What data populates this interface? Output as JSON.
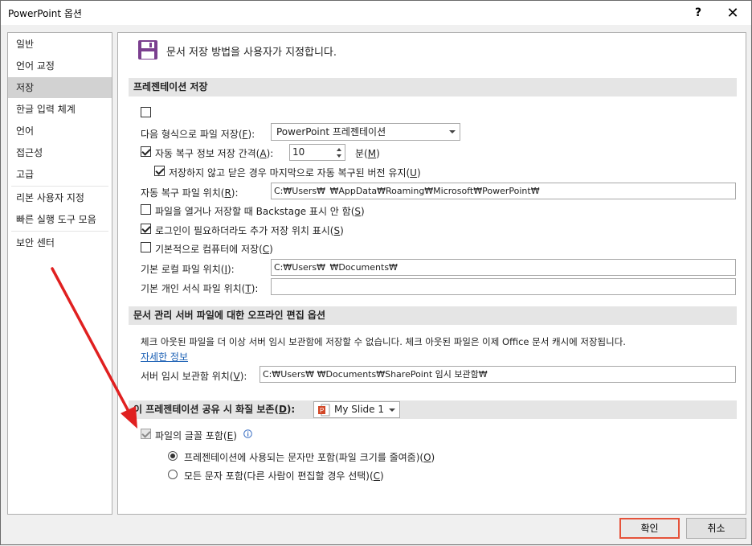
{
  "window": {
    "title": "PowerPoint 옵션",
    "help_label": "?",
    "close_label": "✕"
  },
  "nav": {
    "items": [
      "일반",
      "언어 교정",
      "저장",
      "한글 입력 체계",
      "언어",
      "접근성",
      "고급",
      "리본 사용자 지정",
      "빠른 실행 도구 모음",
      "보안 센터"
    ],
    "selected": "저장"
  },
  "content": {
    "header": "문서 저장 방법을 사용자가 지정합니다.",
    "sections": {
      "save_presentations": "프레젠테이션 저장",
      "offline_editing": "문서 관리 서버 파일에 대한 오프라인 편집 옵션",
      "fidelity": "이 프레젠테이션 공유 시 화질 보존",
      "fidelity_key": "D",
      "fidelity_suffix": "):"
    },
    "save": {
      "format_label": "다음 형식으로 파일 저장(",
      "format_key": "F",
      "format_suffix": "):",
      "format_value": "PowerPoint 프레젠테이션",
      "autorecover_label": "자동 복구 정보 저장 간격(",
      "autorecover_key": "A",
      "autorecover_suffix": "):",
      "autorecover_value": "10",
      "minutes_label": "분(",
      "minutes_key": "M",
      "minutes_suffix": ")",
      "keep_last_label": "저장하지 않고 닫은 경우 마지막으로 자동 복구된 버전 유지(",
      "keep_last_key": "U",
      "keep_last_suffix": ")",
      "autorecover_path_label": "자동 복구 파일 위치(",
      "autorecover_path_key": "R",
      "autorecover_path_suffix": "):",
      "autorecover_path_value": "C:₩Users₩   ₩AppData₩Roaming₩Microsoft₩PowerPoint₩",
      "no_backstage_label": "파일을 열거나 저장할 때 Backstage 표시 안 함(",
      "no_backstage_key": "S",
      "no_backstage_suffix": ")",
      "additional_places_label": "로그인이 필요하더라도 추가 저장 위치 표시(",
      "additional_places_key": "S",
      "additional_places_suffix": ")",
      "save_to_computer_label": "기본적으로 컴퓨터에 저장(",
      "save_to_computer_key": "C",
      "save_to_computer_suffix": ")",
      "local_path_label": "기본 로컬 파일 위치(",
      "local_path_key": "I",
      "local_path_suffix": "):",
      "local_path_value": "C:₩Users₩   ₩Documents₩",
      "template_path_label": "기본 개인 서식 파일 위치(",
      "template_path_key": "T",
      "template_path_suffix": "):",
      "template_path_value": ""
    },
    "offline": {
      "note": "체크 아웃된 파일을 더 이상 서버 임시 보관함에 저장할 수 없습니다. 체크 아웃된 파일은 이제 Office 문서 캐시에 저장됩니다.",
      "more_info": "자세한 정보",
      "drafts_label": "서버 임시 보관함 위치(",
      "drafts_key": "V",
      "drafts_suffix": "):",
      "drafts_value": "C:₩Users₩  ₩Documents₩SharePoint 임시 보관함₩"
    },
    "fidelity": {
      "file_value": "My Slide 1",
      "embed_fonts_label": "파일의 글꼴 포함(",
      "embed_fonts_key": "E",
      "embed_fonts_suffix": ")",
      "radio_used_label": "프레젠테이션에 사용되는 문자만 포함(파일 크기를 줄여줌)(",
      "radio_used_key": "O",
      "radio_used_suffix": ")",
      "radio_all_label": "모든 문자 포함(다른 사람이 편집할 경우 선택)(",
      "radio_all_key": "C",
      "radio_all_suffix": ")"
    }
  },
  "footer": {
    "ok_label": "확인",
    "cancel_label": "취소"
  },
  "colors": {
    "accent": "#e5533b",
    "save_icon": "#7b3f8f",
    "link": "#1a5fb4",
    "arrow": "#e02020"
  }
}
